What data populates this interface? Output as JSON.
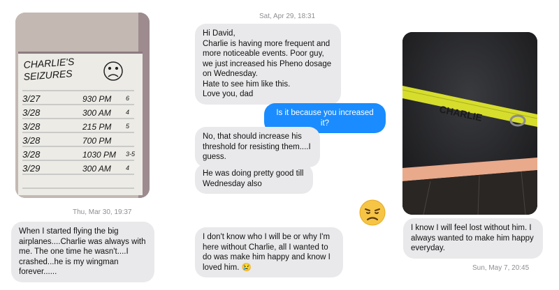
{
  "columns": {
    "left": {
      "photo_alt": "Charlie's Seizures log",
      "log_title_line1": "CHARLIE'S",
      "log_title_line2": "SEIZURES",
      "log_rows": [
        {
          "date": "3/27",
          "time": "9",
          "sup": "30",
          "ampm": "PM",
          "count": "6"
        },
        {
          "date": "3/28",
          "time": "3",
          "sup": "00",
          "ampm": "AM",
          "count": "4"
        },
        {
          "date": "3/28",
          "time": "2",
          "sup": "15",
          "ampm": "PM",
          "count": "5"
        },
        {
          "date": "3/28",
          "time": "7",
          "sup": "00",
          "ampm": "PM",
          "count": ""
        },
        {
          "date": "3/28",
          "time": "10",
          "sup": "30",
          "ampm": "PM",
          "count": "3-5"
        },
        {
          "date": "3/29",
          "time": "3",
          "sup": "00",
          "ampm": "AM",
          "count": "4"
        }
      ],
      "timestamp": "Thu, Mar 30, 19:37",
      "message": "When I started flying the big airplanes....Charlie was always with me. The one time he wasn't....I crashed...he is my wingman forever......"
    },
    "middle": {
      "timestamp": "Sat, Apr 29, 18:31",
      "msg1": "Hi David,\nCharlie is having more frequent and more noticeable events. Poor guy, we just increased his Pheno dosage on Wednesday.\nHate to see him like this.\nLove you, dad",
      "msg2": "Is it because you increased it?",
      "msg3": "No, that should increase his threshold for resisting them....I guess.",
      "msg4": "He was doing pretty good till Wednesday also",
      "msg5": "I don't know who I will be or why I'm here without Charlie, all I wanted to do was make him happy and know I loved him. 😢"
    },
    "right": {
      "photo_alt": "Charlie's collar",
      "collar_text": "CHARLIE",
      "message": "I know I will feel lost without him. I always wanted to make him happy everyday.",
      "timestamp": "Sun, May 7, 20:45"
    }
  },
  "colors": {
    "incoming": "#e9e9eb",
    "outgoing": "#1a8cff",
    "emoji": "#f6c545"
  },
  "icons": [
    "disappointed-face-emoji",
    "sad-face-doodle"
  ]
}
